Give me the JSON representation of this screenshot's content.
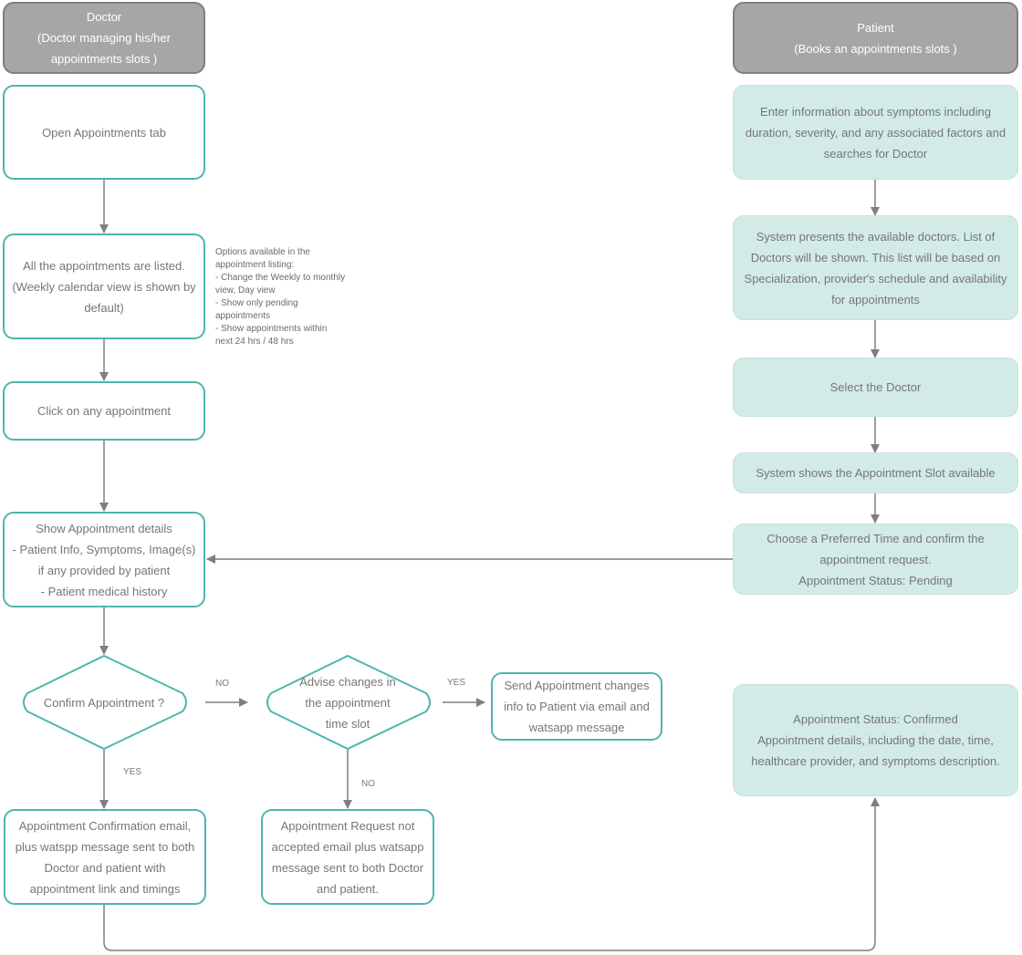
{
  "diagram": {
    "type": "swimlane-flowchart",
    "colors": {
      "lane_header_fill": "#a6a6a6",
      "lane_header_border": "#7f7f7f",
      "doctor_node_border": "#4db6ac",
      "patient_node_fill": "#d2ebe7",
      "connector": "#7f7f7f",
      "text": "#767676"
    }
  },
  "lanes": {
    "doctor": {
      "title": "Doctor",
      "subtitle_line1": "(Doctor managing his/her",
      "subtitle_line2": "appointments slots )"
    },
    "patient": {
      "title": "Patient",
      "subtitle": "(Books an appointments slots )"
    }
  },
  "doctor_nodes": {
    "open_tab": {
      "lines": [
        "Open Appointments tab"
      ]
    },
    "list_appointments": {
      "lines": [
        "All the appointments are listed.",
        "(Weekly calendar view is shown by",
        "default)"
      ]
    },
    "click_appointment": {
      "lines": [
        "Click on any appointment"
      ]
    },
    "show_details": {
      "lines": [
        "Show Appointment details",
        "- Patient Info, Symptoms, Image(s)",
        "if any provided by patient",
        "- Patient medical history"
      ]
    },
    "confirm_decision": {
      "lines": [
        "Confirm Appointment ?"
      ]
    },
    "advise_decision": {
      "lines": [
        "Advise changes in",
        "the appointment",
        "time slot"
      ]
    },
    "send_changes": {
      "lines": [
        "Send Appointment changes",
        "info to Patient via email and",
        "watsapp message"
      ]
    },
    "confirmation_email": {
      "lines": [
        "Appointment Confirmation email,",
        "plus watspp message sent to both",
        "Doctor and patient with",
        "appointment link and timings"
      ]
    },
    "not_accepted_email": {
      "lines": [
        "Appointment Request not",
        "accepted email plus watsapp",
        "message sent to both Doctor",
        "and patient."
      ]
    }
  },
  "note": {
    "lines": [
      "Options available in the",
      "appointment listing:",
      "- Change the Weekly to monthly",
      "view, Day view",
      "- Show only pending",
      "appointments",
      "- Show appointments within",
      "next 24 hrs / 48 hrs"
    ]
  },
  "edge_labels": {
    "confirm_no": "NO",
    "confirm_yes": "YES",
    "advise_yes": "YES",
    "advise_no": "NO"
  },
  "patient_nodes": {
    "enter_symptoms": {
      "lines": [
        "Enter information about symptoms including",
        "duration, severity, and any associated factors and",
        "searches for Doctor"
      ]
    },
    "present_doctors": {
      "lines": [
        "System presents the available doctors. List of",
        "Doctors will be shown. This list will be based on",
        "Specialization, provider's schedule and availability",
        "for appointments"
      ]
    },
    "select_doctor": {
      "lines": [
        "Select the Doctor"
      ]
    },
    "show_slots": {
      "lines": [
        "System shows the Appointment Slot available"
      ]
    },
    "choose_time": {
      "lines": [
        "Choose a Preferred Time and confirm the",
        "appointment request.",
        "Appointment Status: Pending"
      ]
    },
    "confirmed": {
      "lines": [
        "Appointment Status: Confirmed",
        "Appointment details, including the date, time,",
        "healthcare provider, and symptoms description."
      ]
    }
  }
}
